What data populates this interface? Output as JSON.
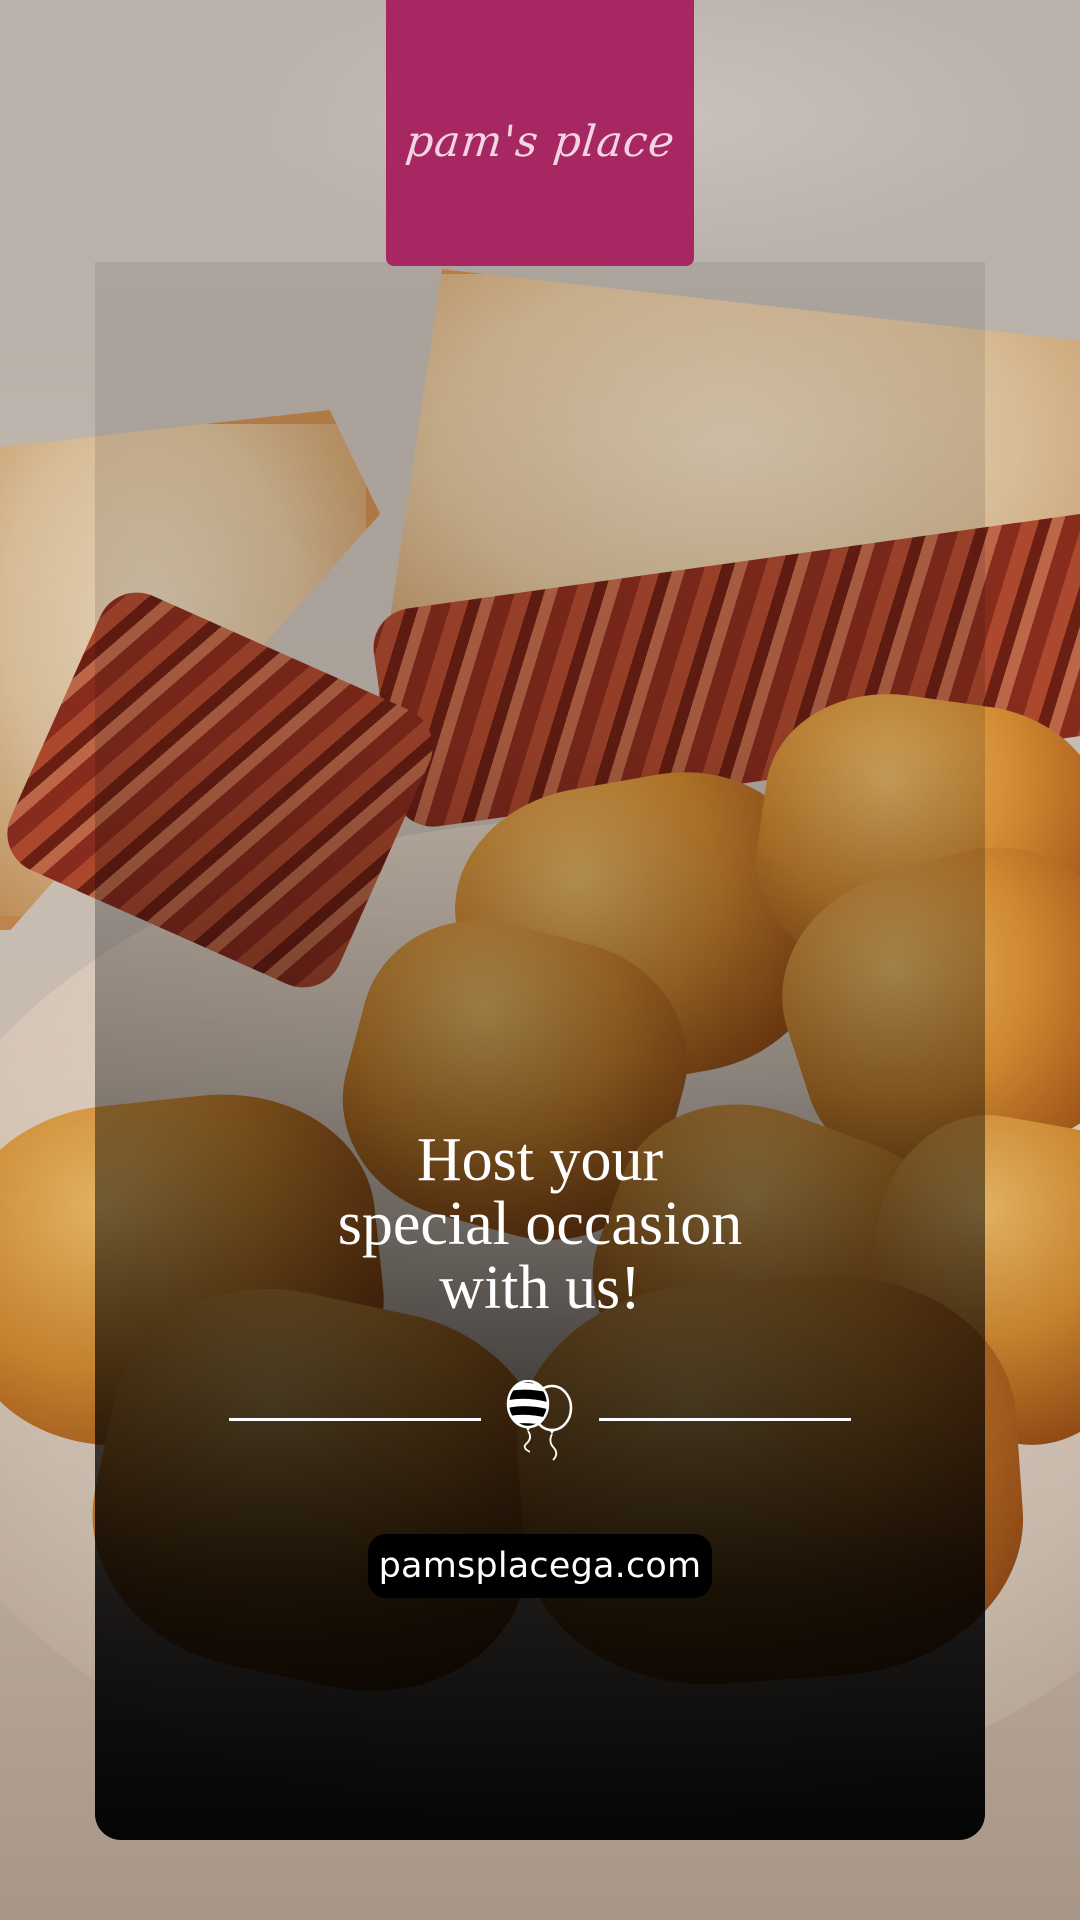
{
  "brand": {
    "logo_text": "pam's place",
    "logo_color": "#a72763"
  },
  "headline": {
    "lines": [
      "Host your",
      "special occasion",
      "with us!"
    ]
  },
  "divider": {
    "icon": "balloons-icon"
  },
  "website": {
    "url": "pamsplacega.com"
  },
  "background": {
    "image": "blt-sandwich-with-tater-tots-photo"
  }
}
